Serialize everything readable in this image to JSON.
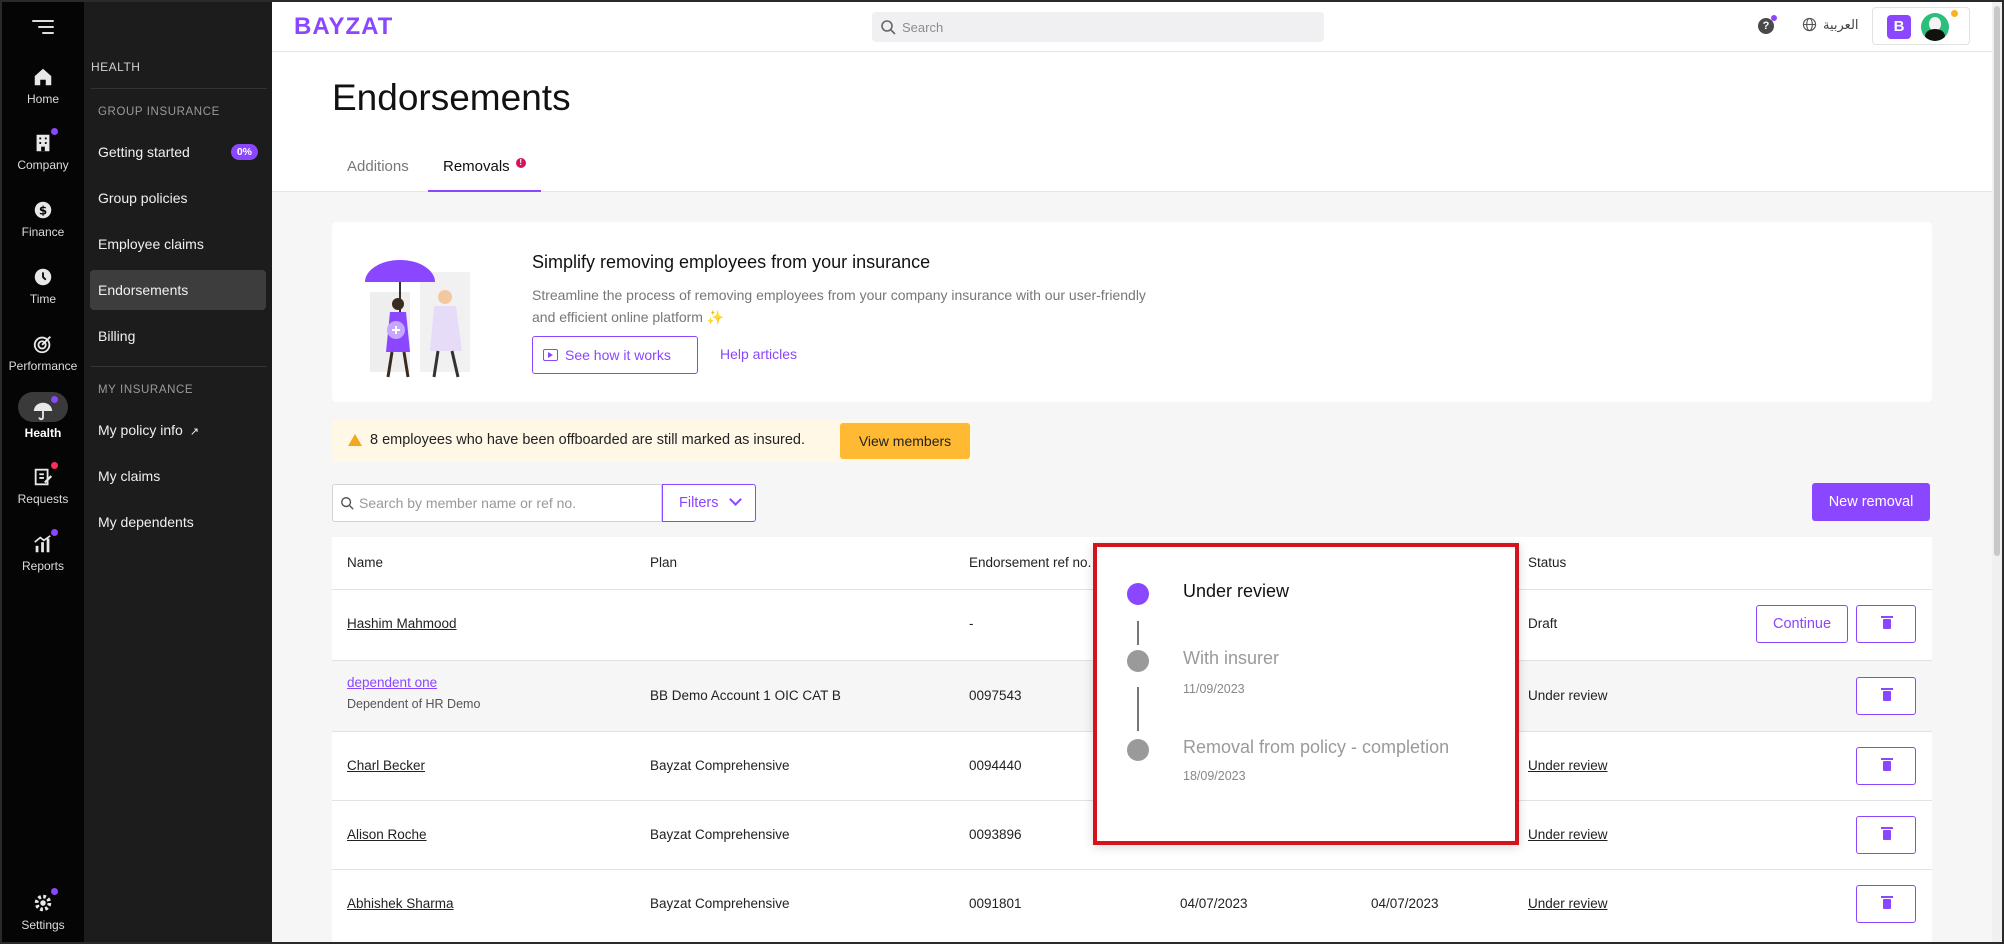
{
  "rail": {
    "items": [
      {
        "label": "Home",
        "icon": "home-icon"
      },
      {
        "label": "Company",
        "icon": "building-icon"
      },
      {
        "label": "Finance",
        "icon": "dollar-icon"
      },
      {
        "label": "Time",
        "icon": "clock-icon"
      },
      {
        "label": "Performance",
        "icon": "target-icon"
      },
      {
        "label": "Health",
        "icon": "umbrella-icon"
      },
      {
        "label": "Requests",
        "icon": "edit-icon"
      },
      {
        "label": "Reports",
        "icon": "bar-chart-icon"
      },
      {
        "label": "Settings",
        "icon": "gear-icon"
      }
    ]
  },
  "sidebar": {
    "heading": "HEALTH",
    "group_insurance": "GROUP INSURANCE",
    "items": [
      {
        "label": "Getting started",
        "badge": "0%"
      },
      {
        "label": "Group policies"
      },
      {
        "label": "Employee claims"
      },
      {
        "label": "Endorsements"
      },
      {
        "label": "Billing"
      }
    ],
    "my_insurance": "MY INSURANCE",
    "my_items": [
      {
        "label": "My policy info"
      },
      {
        "label": "My claims"
      },
      {
        "label": "My dependents"
      }
    ]
  },
  "topbar": {
    "logo": "BAYZAT",
    "search_placeholder": "Search",
    "help": "?",
    "language": "العربية",
    "profile_initial": "B"
  },
  "page": {
    "title": "Endorsements",
    "tabs": [
      {
        "label": "Additions"
      },
      {
        "label": "Removals",
        "alert": "!"
      }
    ]
  },
  "promo": {
    "title": "Simplify removing employees from your insurance",
    "description": "Streamline the process of removing employees from your company insurance with our user-friendly and efficient online platform ✨",
    "see_how": "See how it works",
    "help_articles": "Help articles"
  },
  "warning": {
    "text": "8 employees who have been offboarded are still marked as insured.",
    "button": "View members"
  },
  "toolbar": {
    "search_placeholder": "Search by member name or ref no.",
    "filters": "Filters",
    "new_removal": "New removal"
  },
  "table": {
    "headers": {
      "name": "Name",
      "plan": "Plan",
      "ref": "Endorsement ref no.",
      "status": "Status"
    },
    "rows": [
      {
        "name": "Hashim Mahmood",
        "plan": "",
        "ref": "-",
        "date1": "",
        "date2": "",
        "status": "Draft",
        "action": "Continue"
      },
      {
        "name": "dependent one",
        "sub": "Dependent of HR Demo",
        "plan": "BB Demo Account 1 OIC CAT B",
        "ref": "0097543",
        "date1": "",
        "date2": "",
        "status": "Under review"
      },
      {
        "name": "Charl Becker",
        "plan": "Bayzat Comprehensive",
        "ref": "0094440",
        "date1": "",
        "date2": "",
        "status": "Under review"
      },
      {
        "name": "Alison Roche",
        "plan": "Bayzat Comprehensive",
        "ref": "0093896",
        "date1": "",
        "date2": "",
        "status": "Under review"
      },
      {
        "name": "Abhishek Sharma",
        "plan": "Bayzat Comprehensive",
        "ref": "0091801",
        "date1": "04/07/2023",
        "date2": "04/07/2023",
        "status": "Under review"
      }
    ]
  },
  "popover": {
    "steps": [
      {
        "label": "Under review",
        "date": ""
      },
      {
        "label": "With insurer",
        "date": "11/09/2023"
      },
      {
        "label": "Removal from policy - completion",
        "date": "18/09/2023"
      }
    ]
  }
}
